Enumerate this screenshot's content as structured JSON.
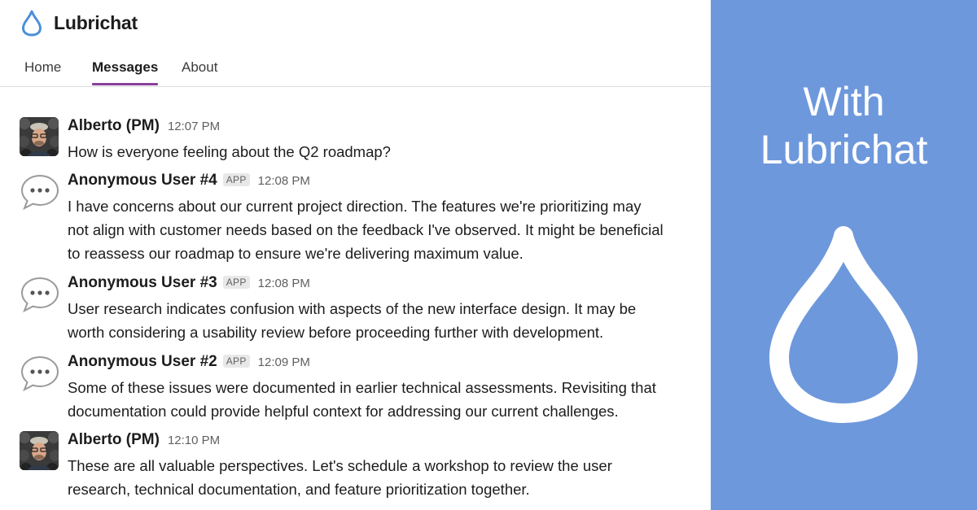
{
  "app": {
    "name": "Lubrichat",
    "brand_color": "#4a8fd8",
    "icon": "droplet-icon"
  },
  "nav": {
    "tabs": [
      {
        "label": "Home",
        "active": false
      },
      {
        "label": "Messages",
        "active": true
      },
      {
        "label": "About",
        "active": false
      }
    ],
    "active_color": "#8a3f9c"
  },
  "messages": [
    {
      "author": "Alberto (PM)",
      "badge": "",
      "time": "12:07 PM",
      "avatar": "photo-avatar",
      "lines": [
        "How is everyone feeling about the Q2 roadmap?"
      ]
    },
    {
      "author": "Anonymous User #4",
      "badge": "APP",
      "time": "12:08 PM",
      "avatar": "speech-bubble-icon",
      "lines": [
        "I have concerns about our current project direction. The features we're prioritizing may",
        "not align with customer needs based on the feedback I've observed. It might be beneficial",
        "to reassess our roadmap to ensure we're delivering maximum value."
      ]
    },
    {
      "author": "Anonymous User #3",
      "badge": "APP",
      "time": "12:08 PM",
      "avatar": "speech-bubble-icon",
      "lines": [
        "User research indicates confusion with aspects of the new interface design. It may be",
        "worth considering a usability review before proceeding further with development."
      ]
    },
    {
      "author": "Anonymous User #2",
      "badge": "APP",
      "time": "12:09 PM",
      "avatar": "speech-bubble-icon",
      "lines": [
        "Some of these issues were documented in earlier technical assessments. Revisiting that",
        "documentation could provide helpful context for addressing our current challenges."
      ]
    },
    {
      "author": "Alberto (PM)",
      "badge": "",
      "time": "12:10 PM",
      "avatar": "photo-avatar",
      "lines": [
        "These are all valuable perspectives. Let's schedule a workshop to review the user",
        "research, technical documentation, and feature prioritization together."
      ]
    }
  ],
  "panel": {
    "title_line1": "With",
    "title_line2": "Lubrichat",
    "background": "#6e98dc",
    "icon": "droplet-icon"
  }
}
